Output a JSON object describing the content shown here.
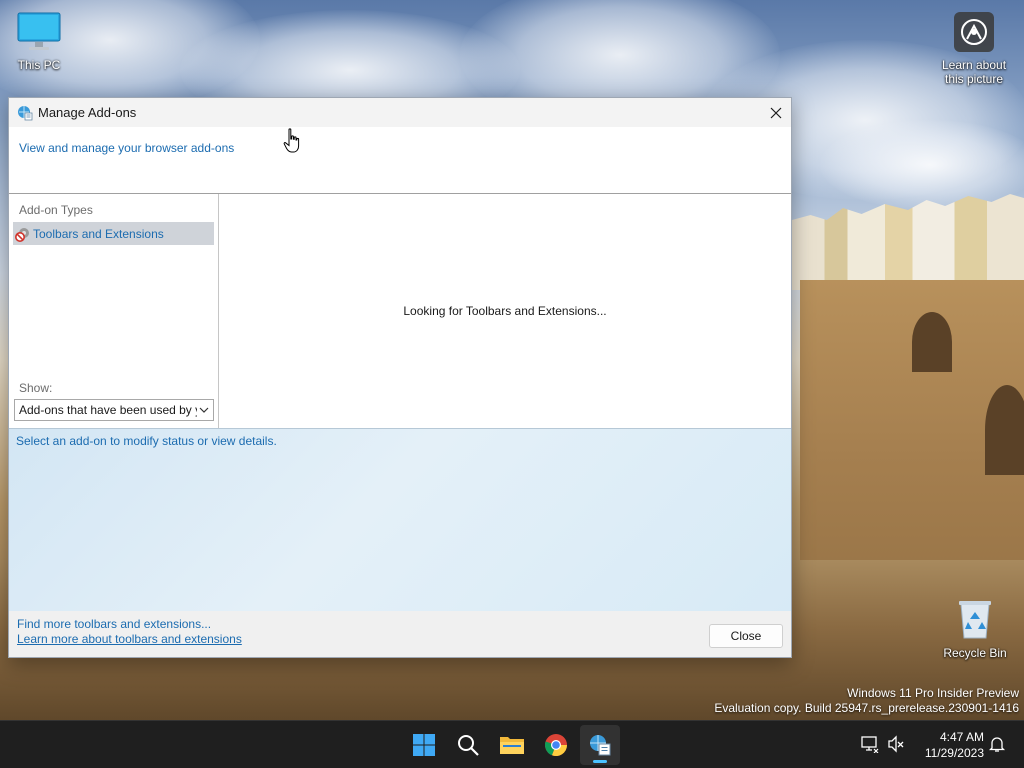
{
  "desktop": {
    "icons": {
      "this_pc": "This PC",
      "learn_line1": "Learn about",
      "learn_line2": "this picture",
      "recycle_bin": "Recycle Bin"
    },
    "watermark": {
      "line1": "Windows 11 Pro Insider Preview",
      "line2": "Evaluation copy. Build 25947.rs_prerelease.230901-1416"
    }
  },
  "dialog": {
    "title": "Manage Add-ons",
    "subheader_link": "View and manage your browser add-ons",
    "sidebar": {
      "group_label": "Add-on Types",
      "items": [
        {
          "label": "Toolbars and Extensions",
          "icon": "gear-blocked-icon",
          "selected": true
        }
      ],
      "show_label": "Show:",
      "show_select_value": "Add-ons that have been used by your browser"
    },
    "content": {
      "status_message": "Looking for Toolbars and Extensions..."
    },
    "details": {
      "hint": "Select an add-on to modify status or view details."
    },
    "footer": {
      "find_more_link": "Find more toolbars and extensions...",
      "learn_more_link": "Learn more about toolbars and extensions",
      "close_button": "Close"
    }
  },
  "taskbar": {
    "apps": [
      "start-icon",
      "search-icon",
      "file-explorer-icon",
      "chrome-icon",
      "manage-addons-icon"
    ],
    "active_app": "manage-addons-icon",
    "clock": {
      "time": "4:47 AM",
      "date": "11/29/2023"
    }
  },
  "colors": {
    "link": "#1c6cb0",
    "selection": "#cfd3d9",
    "taskbar": "#1f1f1f",
    "accent": "#4cc2ff"
  }
}
